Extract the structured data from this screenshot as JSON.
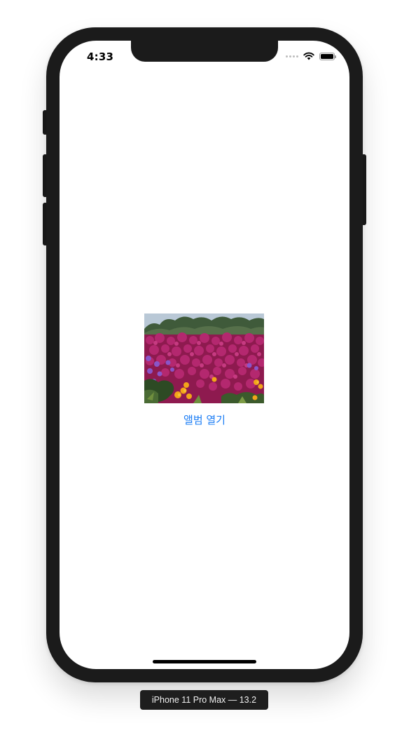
{
  "status_bar": {
    "time": "4:33",
    "icons": [
      "signal-dots-icon",
      "wifi-icon",
      "battery-icon"
    ]
  },
  "content": {
    "image": {
      "description": "photo-of-flowers",
      "icon": "flower-photo"
    },
    "open_album_label": "앨범 열기",
    "accent_color": "#1a7cf5"
  },
  "device": {
    "label": "iPhone 11 Pro Max — 13.2"
  }
}
